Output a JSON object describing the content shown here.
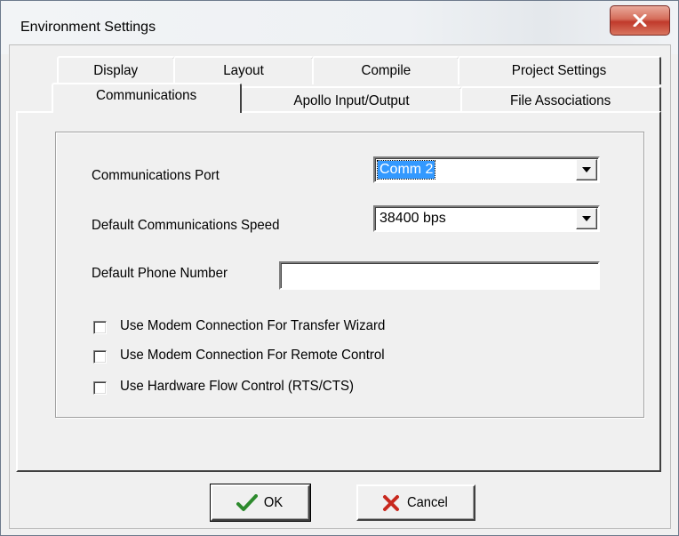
{
  "window": {
    "title": "Environment Settings",
    "close_icon": "close-icon"
  },
  "tabs": {
    "row1": [
      {
        "label": "Display"
      },
      {
        "label": "Layout"
      },
      {
        "label": "Compile"
      },
      {
        "label": "Project Settings"
      }
    ],
    "row2": [
      {
        "label": "Communications",
        "active": true
      },
      {
        "label": "Apollo Input/Output"
      },
      {
        "label": "File Associations"
      }
    ]
  },
  "communications": {
    "port_label": "Communications Port",
    "port_value": "Comm 2",
    "speed_label": "Default Communications Speed",
    "speed_value": "38400 bps",
    "phone_label": "Default Phone Number",
    "phone_value": "",
    "checkboxes": [
      {
        "label": "Use Modem Connection For Transfer Wizard",
        "checked": false
      },
      {
        "label": "Use Modem Connection For Remote Control",
        "checked": false
      },
      {
        "label": "Use Hardware Flow Control (RTS/CTS)",
        "checked": false
      }
    ]
  },
  "buttons": {
    "ok_label": "OK",
    "cancel_label": "Cancel",
    "ok_icon": "checkmark-icon",
    "cancel_icon": "x-icon"
  },
  "colors": {
    "selection": "#3399ff",
    "close_button": "#c0392b",
    "ok_check": "#2d8a2d",
    "cancel_x": "#c8281e"
  }
}
